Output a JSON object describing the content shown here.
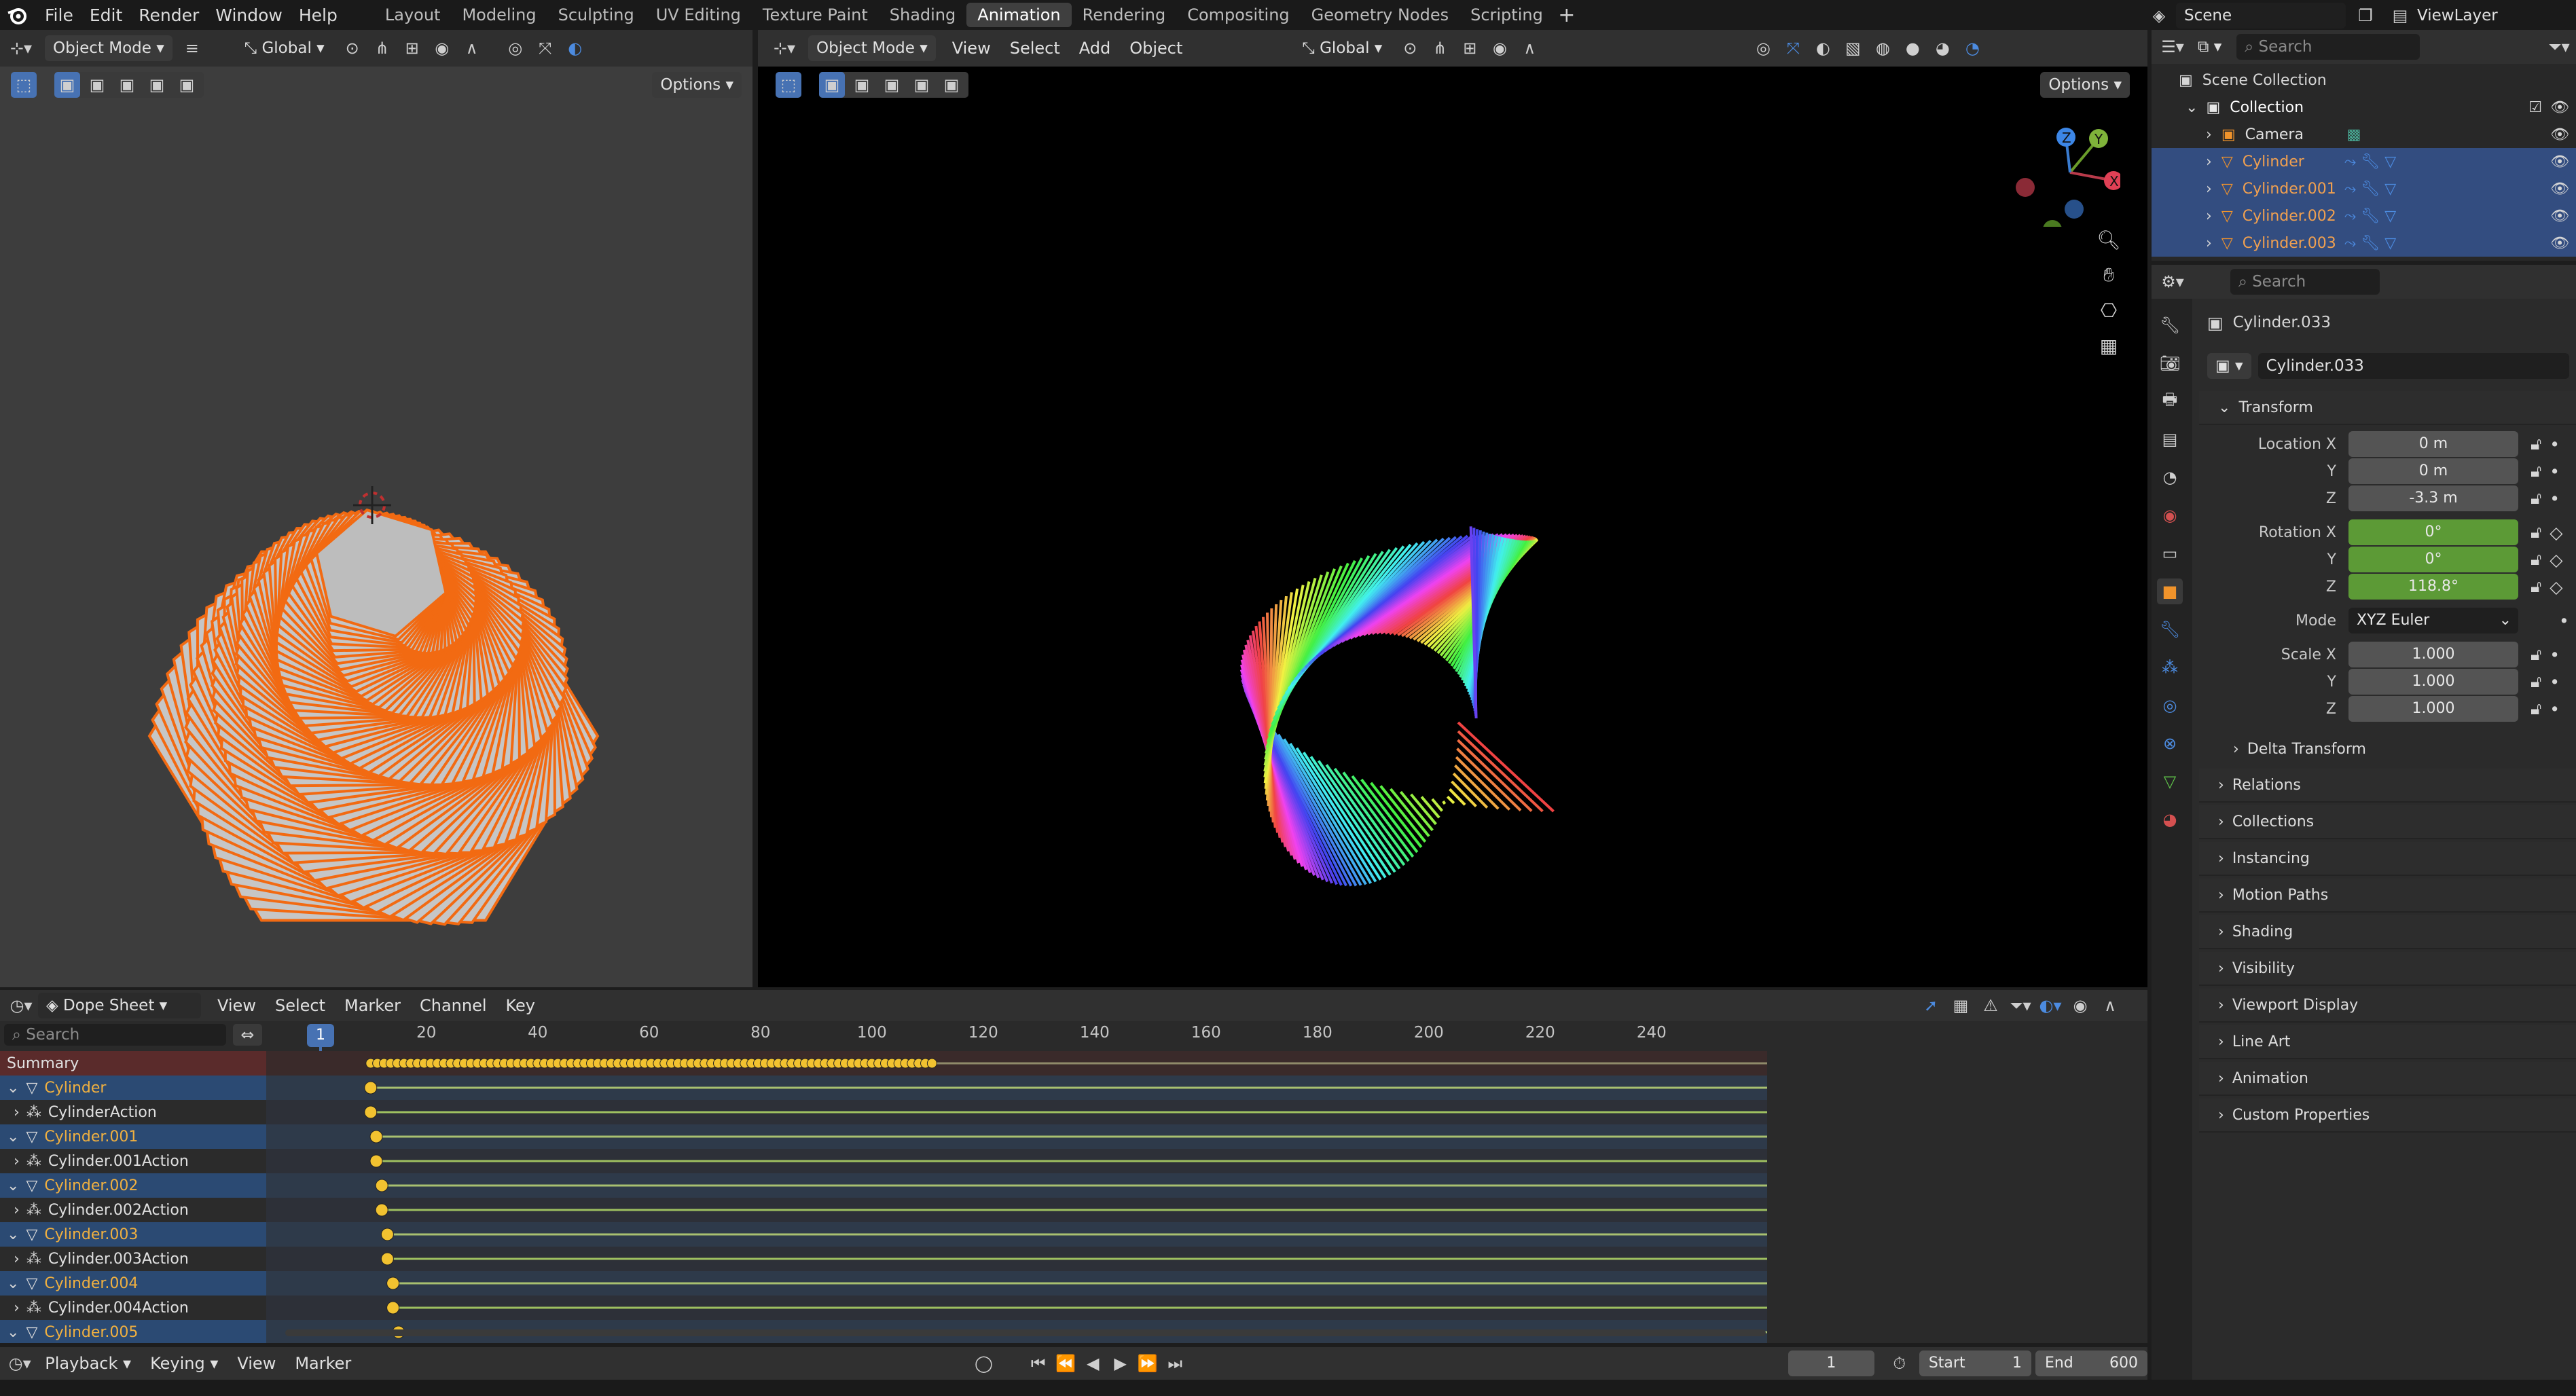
{
  "menubar": {
    "menus": [
      "File",
      "Edit",
      "Render",
      "Window",
      "Help"
    ],
    "workspaces": [
      "Layout",
      "Modeling",
      "Sculpting",
      "UV Editing",
      "Texture Paint",
      "Shading",
      "Animation",
      "Rendering",
      "Compositing",
      "Geometry Nodes",
      "Scripting"
    ],
    "active_workspace": "Animation",
    "scene": "Scene",
    "view_layer": "ViewLayer"
  },
  "left_viewport": {
    "mode": "Object Mode",
    "orientation": "Global",
    "options": "Options",
    "object_color": "#f26a12"
  },
  "main_viewport": {
    "mode": "Object Mode",
    "menus": [
      "View",
      "Select",
      "Add",
      "Object"
    ],
    "orientation": "Global",
    "options": "Options"
  },
  "outliner": {
    "search_placeholder": "Search",
    "root": "Scene Collection",
    "collection": "Collection",
    "items": [
      {
        "name": "Camera",
        "selected": false
      },
      {
        "name": "Cylinder",
        "selected": true
      },
      {
        "name": "Cylinder.001",
        "selected": true
      },
      {
        "name": "Cylinder.002",
        "selected": true
      },
      {
        "name": "Cylinder.003",
        "selected": true
      }
    ]
  },
  "properties": {
    "search_placeholder": "Search",
    "object_name": "Cylinder.033",
    "object_field": "Cylinder.033",
    "transform_title": "Transform",
    "location_label": "Location X",
    "location": [
      "0 m",
      "0 m",
      "-3.3 m"
    ],
    "rotation_label": "Rotation X",
    "rotation": [
      "0°",
      "0°",
      "118.8°"
    ],
    "mode_label": "Mode",
    "mode_value": "XYZ Euler",
    "scale_label": "Scale X",
    "scale": [
      "1.000",
      "1.000",
      "1.000"
    ],
    "axis_y": "Y",
    "axis_z": "Z",
    "delta_transform": "Delta Transform",
    "sections": [
      "Relations",
      "Collections",
      "Instancing",
      "Motion Paths",
      "Shading",
      "Visibility",
      "Viewport Display",
      "Line Art",
      "Animation",
      "Custom Properties"
    ]
  },
  "dopesheet": {
    "editor": "Dope Sheet",
    "menus": [
      "View",
      "Select",
      "Marker",
      "Channel",
      "Key"
    ],
    "search_placeholder": "Search",
    "current_frame": "1",
    "ticks": [
      "20",
      "40",
      "60",
      "80",
      "100",
      "120",
      "140",
      "160",
      "180",
      "200",
      "220",
      "240"
    ],
    "channels": [
      {
        "label": "Summary",
        "kind": "summary"
      },
      {
        "label": "Cylinder",
        "kind": "object"
      },
      {
        "label": "CylinderAction",
        "kind": "action"
      },
      {
        "label": "Cylinder.001",
        "kind": "object"
      },
      {
        "label": "Cylinder.001Action",
        "kind": "action"
      },
      {
        "label": "Cylinder.002",
        "kind": "object"
      },
      {
        "label": "Cylinder.002Action",
        "kind": "action"
      },
      {
        "label": "Cylinder.003",
        "kind": "object"
      },
      {
        "label": "Cylinder.003Action",
        "kind": "action"
      },
      {
        "label": "Cylinder.004",
        "kind": "object"
      },
      {
        "label": "Cylinder.004Action",
        "kind": "action"
      },
      {
        "label": "Cylinder.005",
        "kind": "object"
      }
    ],
    "summary_key_range": [
      10,
      111
    ],
    "key_frames": [
      10,
      10,
      11,
      11,
      12,
      12,
      13,
      13,
      14,
      14,
      15
    ]
  },
  "timeline": {
    "menus": [
      "Playback",
      "Keying",
      "View",
      "Marker"
    ],
    "frame": "1",
    "start_label": "Start",
    "start": "1",
    "end_label": "End",
    "end": "600"
  }
}
